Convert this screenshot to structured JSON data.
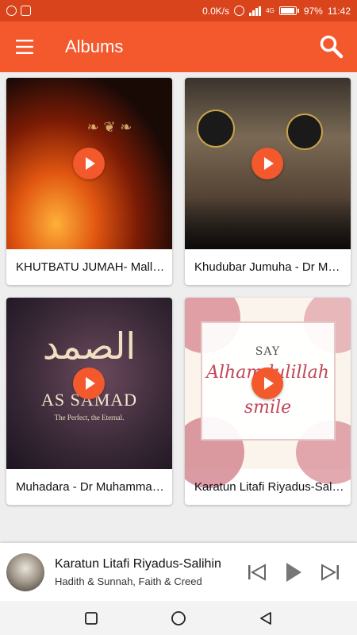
{
  "status_bar": {
    "speed": "0.0K/s",
    "network": "4G",
    "battery": "97%",
    "battery_level": 0.97,
    "time": "11:42"
  },
  "app_bar": {
    "title": "Albums"
  },
  "colors": {
    "primary": "#f4582d",
    "status_bar": "#d9441c"
  },
  "albums": [
    {
      "title": "KHUTBATU JUMAH- Mallam Muhammad"
    },
    {
      "title": "Khudubar Jumuha - Dr Muhammad"
    },
    {
      "title": "Muhadara - Dr Muhammad Sani"
    },
    {
      "title": "Karatun Litafi Riyadus-Salihin"
    }
  ],
  "art": {
    "album3_caption": "AS SAMAD",
    "album3_tagline": "The Perfect, the Eternal.",
    "album4_top": "SAY",
    "album4_main": "Alhamdulillah",
    "album4_bottom": "smile"
  },
  "player": {
    "title": "Karatun Litafi Riyadus-Salihin",
    "subtitle": "Hadith & Sunnah, Faith & Creed"
  },
  "icons": [
    "whatsapp-icon",
    "cast-icon",
    "alarm-icon",
    "signal-icon",
    "battery-icon",
    "menu-icon",
    "search-icon",
    "play-icon",
    "skip-previous-icon",
    "skip-next-icon",
    "nav-square-icon",
    "nav-circle-icon",
    "nav-back-icon"
  ]
}
